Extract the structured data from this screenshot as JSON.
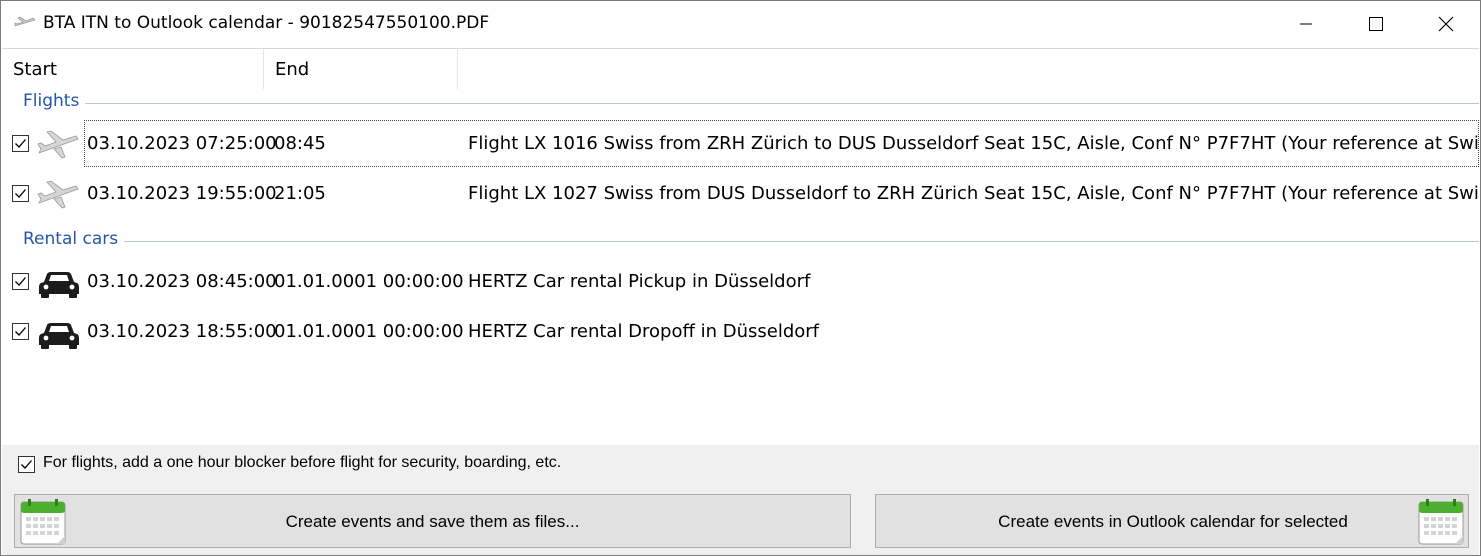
{
  "window": {
    "title": "BTA ITN to Outlook calendar - 90182547550100.PDF"
  },
  "columns": {
    "start": "Start",
    "end": "End"
  },
  "groups": {
    "flights": {
      "label": "Flights",
      "rows": [
        {
          "checked": true,
          "icon": "airplane-icon",
          "start": "03.10.2023 07:25:00",
          "end": "08:45",
          "description": "Flight LX 1016 Swiss from ZRH Zürich to DUS Dusseldorf Seat 15C, Aisle, Conf N° P7F7HT (Your reference at Swis"
        },
        {
          "checked": true,
          "icon": "airplane-icon",
          "start": "03.10.2023 19:55:00",
          "end": "21:05",
          "description": "Flight LX 1027 Swiss from DUS Dusseldorf to ZRH Zürich Seat 15C, Aisle, Conf N° P7F7HT (Your reference at Swis"
        }
      ]
    },
    "rental_cars": {
      "label": "Rental cars",
      "rows": [
        {
          "checked": true,
          "icon": "car-icon",
          "start": "03.10.2023 08:45:00",
          "end": "01.01.0001 00:00:00",
          "description": "HERTZ Car rental Pickup in Düsseldorf"
        },
        {
          "checked": true,
          "icon": "car-icon",
          "start": "03.10.2023 18:55:00",
          "end": "01.01.0001 00:00:00",
          "description": "HERTZ Car rental Dropoff in Düsseldorf"
        }
      ]
    }
  },
  "options": {
    "blocker_checked": true,
    "blocker_label": "For flights, add a one hour blocker before flight for security, boarding, etc."
  },
  "buttons": {
    "save_files": "Create events and save them as files...",
    "outlook": "Create events in Outlook calendar for selected"
  },
  "colors": {
    "group_label": "#2456a8",
    "button_face": "#e1e1e1",
    "panel": "#f0f0f0",
    "calendar_green": "#4caf2e"
  }
}
